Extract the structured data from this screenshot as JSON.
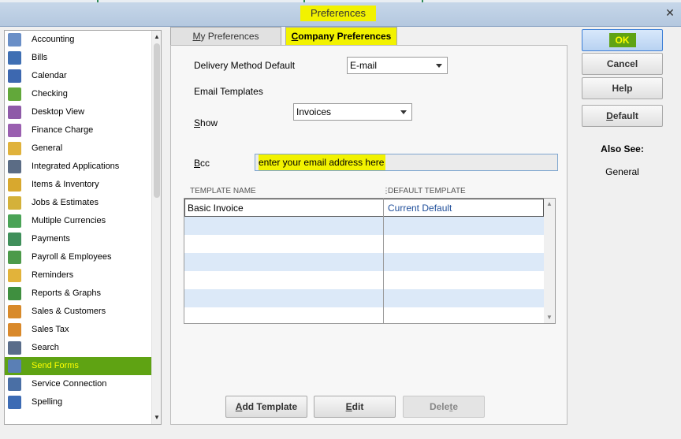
{
  "window": {
    "title": "Preferences",
    "close_glyph": "✕"
  },
  "sidebar": {
    "items": [
      {
        "label": "Accounting",
        "icon": "accounting-icon",
        "color": "#6a8fc7"
      },
      {
        "label": "Bills",
        "icon": "bills-icon",
        "color": "#3f6fb3"
      },
      {
        "label": "Calendar",
        "icon": "calendar-icon",
        "color": "#3d68b0"
      },
      {
        "label": "Checking",
        "icon": "checking-icon",
        "color": "#62a83a"
      },
      {
        "label": "Desktop View",
        "icon": "desktop-view-icon",
        "color": "#8e5aa8"
      },
      {
        "label": "Finance Charge",
        "icon": "finance-charge-icon",
        "color": "#9a5fb0"
      },
      {
        "label": "General",
        "icon": "general-icon",
        "color": "#e0b23b"
      },
      {
        "label": "Integrated Applications",
        "icon": "integrated-applications-icon",
        "color": "#5b6c85"
      },
      {
        "label": "Items & Inventory",
        "icon": "items-inventory-icon",
        "color": "#d8a82e"
      },
      {
        "label": "Jobs & Estimates",
        "icon": "jobs-estimates-icon",
        "color": "#d4b13a"
      },
      {
        "label": "Multiple Currencies",
        "icon": "multiple-currencies-icon",
        "color": "#4aa356"
      },
      {
        "label": "Payments",
        "icon": "payments-icon",
        "color": "#3f8f5a"
      },
      {
        "label": "Payroll & Employees",
        "icon": "payroll-employees-icon",
        "color": "#4c9a49"
      },
      {
        "label": "Reminders",
        "icon": "reminders-icon",
        "color": "#e2b33a"
      },
      {
        "label": "Reports & Graphs",
        "icon": "reports-graphs-icon",
        "color": "#3f8f3f"
      },
      {
        "label": "Sales & Customers",
        "icon": "sales-customers-icon",
        "color": "#d88a2a"
      },
      {
        "label": "Sales Tax",
        "icon": "sales-tax-icon",
        "color": "#d9892b"
      },
      {
        "label": "Search",
        "icon": "search-icon",
        "color": "#5a6d8a"
      },
      {
        "label": "Send Forms",
        "icon": "send-forms-icon",
        "color": "#5a7fb5",
        "selected": true
      },
      {
        "label": "Service Connection",
        "icon": "service-connection-icon",
        "color": "#4a6fa5"
      },
      {
        "label": "Spelling",
        "icon": "spelling-icon",
        "color": "#3c6bb4"
      }
    ]
  },
  "tabs": {
    "my_prefix": "M",
    "my_rest": "y Preferences",
    "company_prefix": "C",
    "company_rest": "ompany Preferences"
  },
  "form": {
    "delivery_label": "Delivery Method Default",
    "delivery_value": "E-mail",
    "email_templates_label": "Email Templates",
    "show_prefix": "S",
    "show_rest": "how",
    "show_value": "Invoices",
    "bcc_prefix": "B",
    "bcc_rest": "cc",
    "bcc_value": "enter your email address here"
  },
  "table": {
    "columns": [
      "TEMPLATE NAME",
      "DEFAULT TEMPLATE"
    ],
    "rows": [
      {
        "name": "Basic Invoice",
        "default": "Current Default"
      }
    ]
  },
  "bottom_buttons": {
    "add_prefix": "A",
    "add_rest": "dd Template",
    "edit_prefix": "E",
    "edit_rest": "dit",
    "delete_prefix": "Dele",
    "delete_u": "t",
    "delete_rest": "e"
  },
  "right_buttons": {
    "ok": "OK",
    "cancel": "Cancel",
    "help": "Help",
    "default_prefix": "D",
    "default_rest": "efault"
  },
  "also_see": {
    "label": "Also See:",
    "link": "General"
  }
}
